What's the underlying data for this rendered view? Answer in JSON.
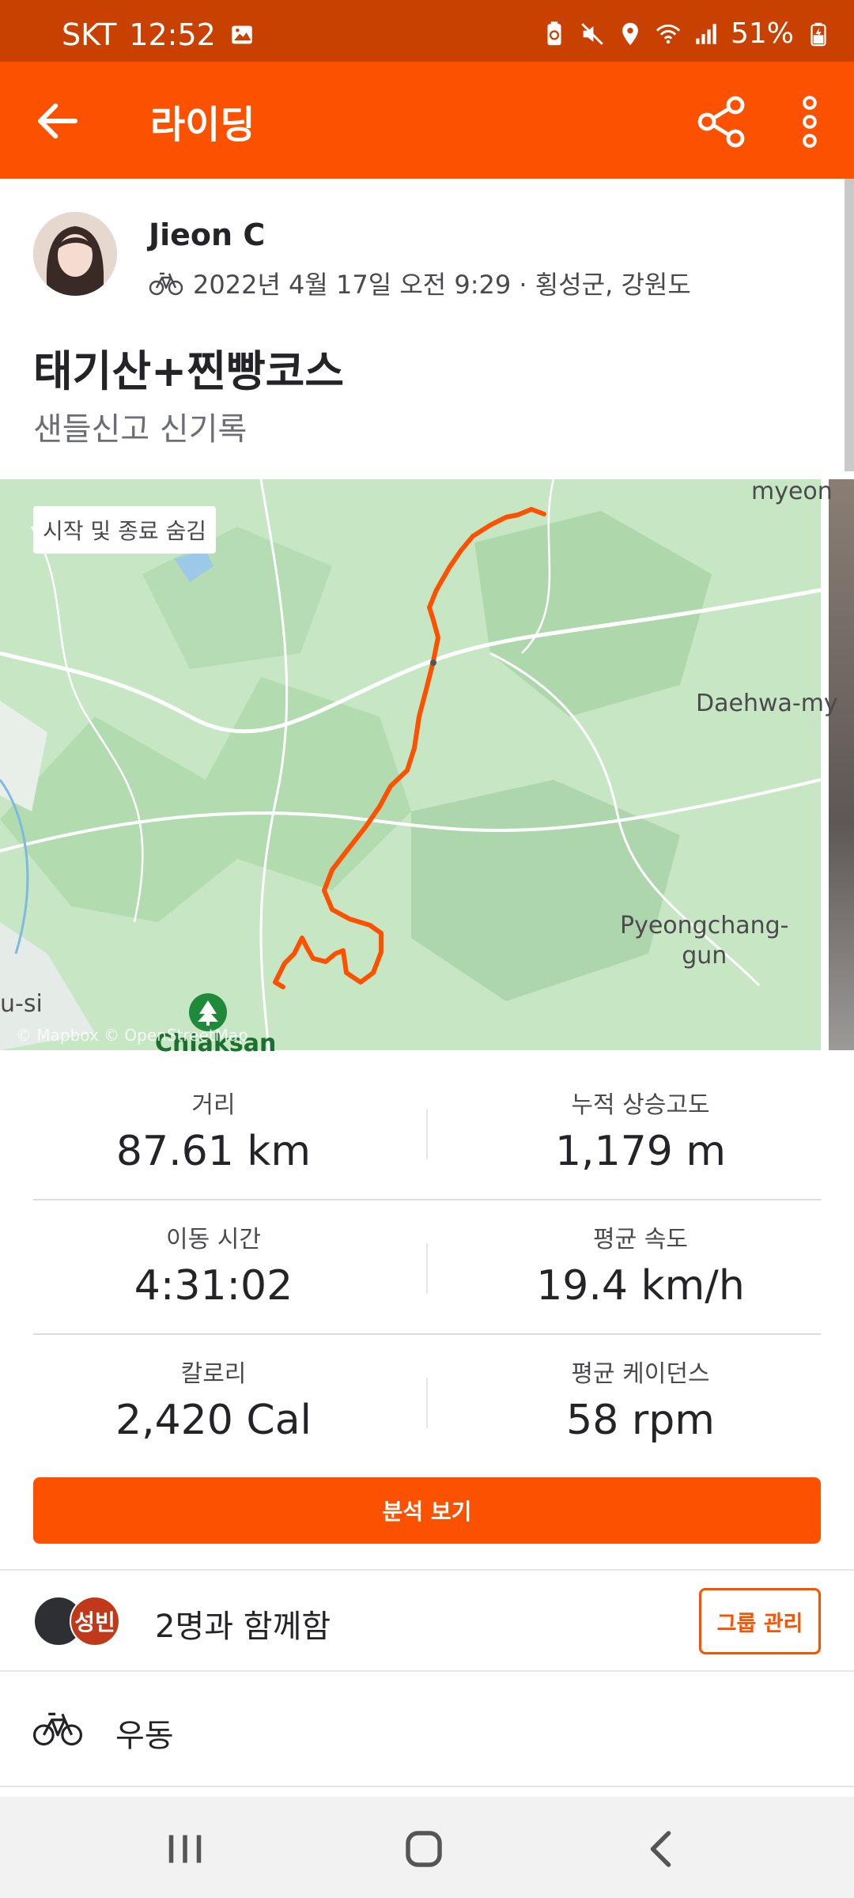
{
  "status_bar": {
    "carrier": "SKT",
    "time": "12:52",
    "battery": "51%",
    "icons": [
      "image-icon",
      "battery-saver-icon",
      "mute-icon",
      "location-icon",
      "wifi-icon",
      "signal-icon",
      "battery-charging-icon"
    ]
  },
  "app_bar": {
    "title": "라이딩",
    "back_icon": "arrow-left-icon",
    "share_icon": "share-icon",
    "more_icon": "more-vertical-icon"
  },
  "athlete": {
    "name": "Jieon C",
    "activity_icon": "bicycle-icon",
    "datetime_location": "2022년 4월 17일 오전 9:29 · 횡성군, 강원도"
  },
  "activity": {
    "title": "태기산+찐빵코스",
    "description": "샌들신고 신기록"
  },
  "map": {
    "chip_label": "시작 및 종료 숨김",
    "place_labels": [
      "myeon",
      "Daehwa-my",
      "Pyeongchang-\ngun",
      "u-si",
      "Chiaksan"
    ],
    "attribution": "© Mapbox © OpenStreetMap",
    "route_color": "#fc5200",
    "park_icon": "tree-icon"
  },
  "stats": [
    {
      "label": "거리",
      "value": "87.61 km"
    },
    {
      "label": "누적 상승고도",
      "value": "1,179 m"
    },
    {
      "label": "이동 시간",
      "value": "4:31:02"
    },
    {
      "label": "평균 속도",
      "value": "19.4 km/h"
    },
    {
      "label": "칼로리",
      "value": "2,420 Cal"
    },
    {
      "label": "평균 케이던스",
      "value": "58 rpm"
    }
  ],
  "analyze_button": "분석 보기",
  "group": {
    "avatar2_text": "성빈",
    "text": "2명과 함께함",
    "button": "그룹 관리"
  },
  "gear": {
    "icon": "bicycle-icon",
    "name": "우동"
  },
  "nav_bar": {
    "recents_icon": "recents-icon",
    "home_icon": "home-icon",
    "back_icon": "back-chevron-icon"
  },
  "colors": {
    "brand": "#fc5200",
    "status_bar": "#c84100",
    "map_bg": "#c6e6c4"
  }
}
